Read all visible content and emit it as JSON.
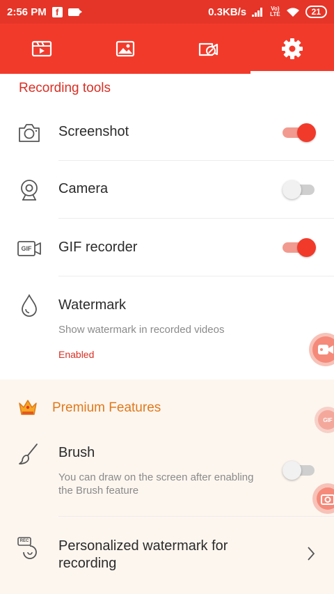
{
  "status": {
    "time": "2:56 PM",
    "fb": "f",
    "network": "0.3KB/s",
    "carrier_top": "Vo)",
    "carrier_bottom": "LTE",
    "battery": "21"
  },
  "tabs": [
    {
      "icon": "video-list-icon",
      "active": false
    },
    {
      "icon": "image-icon",
      "active": false
    },
    {
      "icon": "video-edit-icon",
      "active": false
    },
    {
      "icon": "gear-icon",
      "active": true
    }
  ],
  "recording_tools": {
    "title": "Recording tools",
    "items": [
      {
        "label": "Screenshot",
        "icon": "camera-icon",
        "enabled": true
      },
      {
        "label": "Camera",
        "icon": "webcam-icon",
        "enabled": false
      },
      {
        "label": "GIF recorder",
        "icon": "gif-icon",
        "icon_text": "GIF",
        "enabled": true
      },
      {
        "label": "Watermark",
        "icon": "drop-icon",
        "subtitle": "Show watermark in recorded videos",
        "state": "Enabled"
      }
    ]
  },
  "premium": {
    "title": "Premium Features",
    "icon": "crown-icon",
    "items": [
      {
        "label": "Brush",
        "icon": "brush-icon",
        "subtitle_lines": [
          "You can draw on the screen after enabling",
          "the Brush feature"
        ],
        "enabled": false
      },
      {
        "label_lines": [
          "Personalized watermark for",
          "recording"
        ],
        "icon": "rec-watermark-icon",
        "icon_text": "REC"
      }
    ]
  },
  "floating": {
    "gif_text": "GIF"
  },
  "colors": {
    "accent": "#f23a2b",
    "accent_dark": "#e53528",
    "premium_bg": "#fdf6ef",
    "premium_text": "#e0791a"
  }
}
